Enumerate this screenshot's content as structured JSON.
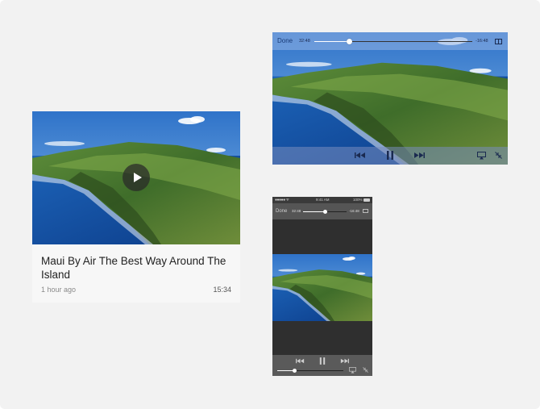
{
  "card": {
    "title": "Maui By Air The Best Way Around The Island",
    "meta": "1 hour ago",
    "duration": "15:34",
    "play_icon": "play-icon"
  },
  "landscape_player": {
    "done_label": "Done",
    "elapsed": "32:48",
    "remaining": "-16:48",
    "progress": 0.22,
    "icons": [
      "previous-icon",
      "pause-icon",
      "next-icon",
      "airplay-icon",
      "exit-fullscreen-icon",
      "aspect-icon"
    ]
  },
  "portrait_player": {
    "status_time": "9:41 AM",
    "status_battery": "100%",
    "done_label": "Done",
    "elapsed": "32:48",
    "remaining": "-16:48",
    "progress": 0.5,
    "volume": 0.25,
    "icons": [
      "previous-icon",
      "pause-icon",
      "next-icon",
      "airplay-icon",
      "exit-fullscreen-icon",
      "aspect-icon"
    ]
  },
  "colors": {
    "background": "#f2f2f2",
    "player_tint": "#96b4e6",
    "portrait_chrome": "#555555"
  }
}
